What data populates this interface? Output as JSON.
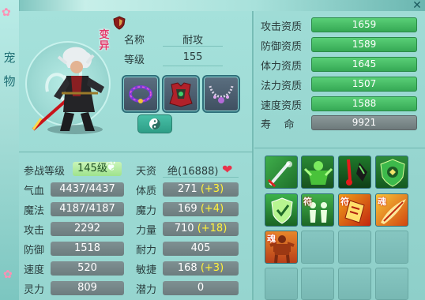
{
  "side_tab": {
    "chars": [
      "宠",
      "物"
    ]
  },
  "window": {
    "close_icon": "✕"
  },
  "pet": {
    "mutation_label": [
      "变",
      "异"
    ],
    "name_label": "名称",
    "name": "耐攻",
    "level_label": "等级",
    "level": "155"
  },
  "stats": {
    "join_level_label": "参战等级",
    "join_level": "145级",
    "talent_label": "天资",
    "talent": "绝(16888)",
    "rows": [
      {
        "label": "气血",
        "value": "4437/4437",
        "attr_label": "体质",
        "attr_value": "271",
        "attr_bonus": "(+3)"
      },
      {
        "label": "魔法",
        "value": "4187/4187",
        "attr_label": "魔力",
        "attr_value": "169",
        "attr_bonus": "(+4)"
      },
      {
        "label": "攻击",
        "value": "2292",
        "attr_label": "力量",
        "attr_value": "710",
        "attr_bonus": "(+18)"
      },
      {
        "label": "防御",
        "value": "1518",
        "attr_label": "耐力",
        "attr_value": "405",
        "attr_bonus": ""
      },
      {
        "label": "速度",
        "value": "520",
        "attr_label": "敏捷",
        "attr_value": "168",
        "attr_bonus": "(+3)"
      },
      {
        "label": "灵力",
        "value": "809",
        "attr_label": "潜力",
        "attr_value": "0",
        "attr_bonus": ""
      }
    ]
  },
  "aptitudes": [
    {
      "label": "攻击资质",
      "value": "1659"
    },
    {
      "label": "防御资质",
      "value": "1589"
    },
    {
      "label": "体力资质",
      "value": "1645"
    },
    {
      "label": "法力资质",
      "value": "1507"
    },
    {
      "label": "速度资质",
      "value": "1588"
    }
  ],
  "lifespan": {
    "label": "寿    命",
    "value": "9921"
  },
  "skills": [
    {
      "name": "sword-skill-icon",
      "glyph": ""
    },
    {
      "name": "green-warrior-skill-icon",
      "glyph": ""
    },
    {
      "name": "red-blood-skill-icon",
      "glyph": ""
    },
    {
      "name": "green-armor-skill-icon",
      "glyph": ""
    },
    {
      "name": "green-shield-skill-icon",
      "glyph": ""
    },
    {
      "name": "green-figures-skill-icon",
      "glyph": "符"
    },
    {
      "name": "fire-talisman-skill-icon",
      "glyph": "符"
    },
    {
      "name": "flame-blade-skill-icon",
      "glyph": "魂"
    },
    {
      "name": "muscle-soul-skill-icon",
      "glyph": "魂"
    }
  ],
  "colors": {
    "accent": "#2a8b48",
    "bonus": "#fff23b",
    "mutation": "#e23a6b"
  }
}
